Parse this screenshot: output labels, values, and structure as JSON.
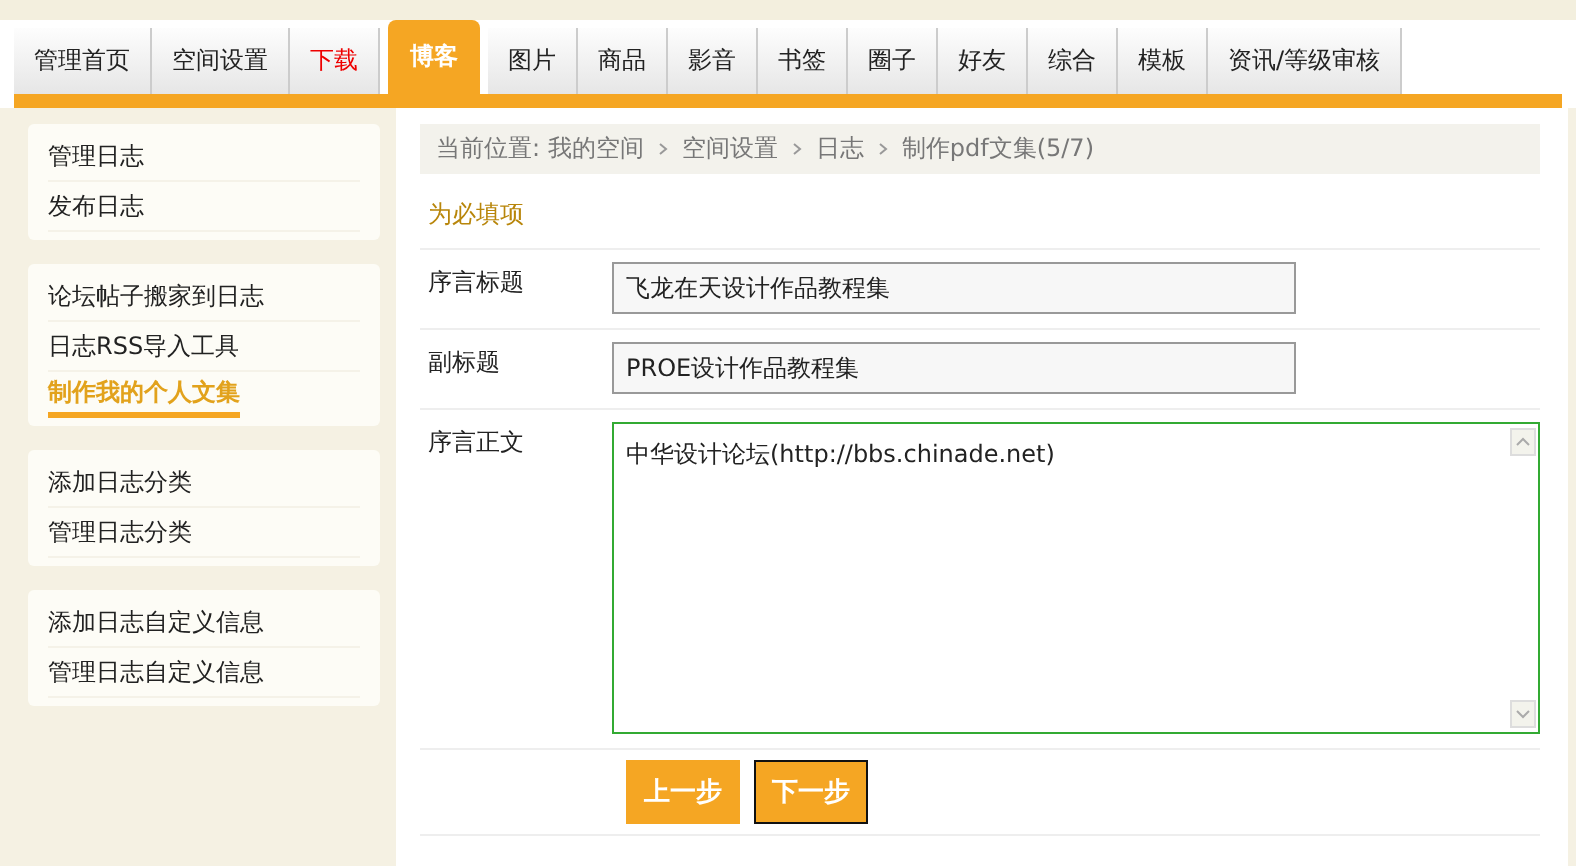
{
  "tabs": [
    {
      "label": "管理首页",
      "selected": false,
      "kind": "normal"
    },
    {
      "label": "空间设置",
      "selected": false,
      "kind": "normal"
    },
    {
      "label": "下载",
      "selected": false,
      "kind": "hot"
    },
    {
      "label": "博客",
      "selected": true,
      "kind": "normal"
    },
    {
      "label": "图片",
      "selected": false,
      "kind": "normal"
    },
    {
      "label": "商品",
      "selected": false,
      "kind": "normal"
    },
    {
      "label": "影音",
      "selected": false,
      "kind": "normal"
    },
    {
      "label": "书签",
      "selected": false,
      "kind": "normal"
    },
    {
      "label": "圈子",
      "selected": false,
      "kind": "normal"
    },
    {
      "label": "好友",
      "selected": false,
      "kind": "normal"
    },
    {
      "label": "综合",
      "selected": false,
      "kind": "normal"
    },
    {
      "label": "模板",
      "selected": false,
      "kind": "normal"
    },
    {
      "label": "资讯/等级审核",
      "selected": false,
      "kind": "normal"
    }
  ],
  "sidebar": {
    "groups": [
      {
        "items": [
          {
            "label": "管理日志",
            "selected": false
          },
          {
            "label": "发布日志",
            "selected": false
          }
        ]
      },
      {
        "items": [
          {
            "label": "论坛帖子搬家到日志",
            "selected": false
          },
          {
            "label": "日志RSS导入工具",
            "selected": false
          },
          {
            "label": "制作我的个人文集",
            "selected": true
          }
        ]
      },
      {
        "items": [
          {
            "label": "添加日志分类",
            "selected": false
          },
          {
            "label": "管理日志分类",
            "selected": false
          }
        ]
      },
      {
        "items": [
          {
            "label": "添加日志自定义信息",
            "selected": false
          },
          {
            "label": "管理日志自定义信息",
            "selected": false
          }
        ]
      }
    ]
  },
  "breadcrumb": [
    "当前位置: 我的空间",
    "空间设置",
    "日志",
    "制作pdf文集(5/7)"
  ],
  "form": {
    "required_note": "为必填项",
    "fields": [
      {
        "label": "序言标题",
        "kind": "input",
        "value": "飞龙在天设计作品教程集",
        "focused": false
      },
      {
        "label": "副标题",
        "kind": "input",
        "value": "PROE设计作品教程集",
        "focused": false
      },
      {
        "label": "序言正文",
        "kind": "textarea",
        "value": "中华设计论坛(http://bbs.chinade.net)",
        "focused": true
      }
    ],
    "buttons": [
      {
        "label": "上一步",
        "selected": false
      },
      {
        "label": "下一步",
        "selected": true
      }
    ]
  }
}
